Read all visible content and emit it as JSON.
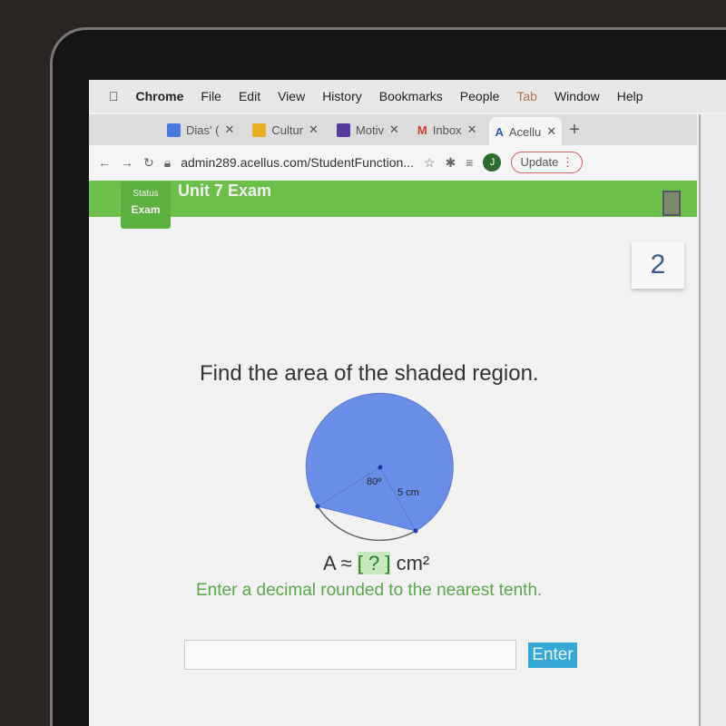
{
  "menubar": {
    "items": [
      "Chrome",
      "File",
      "Edit",
      "View",
      "History",
      "Bookmarks",
      "People",
      "Tab",
      "Window",
      "Help"
    ]
  },
  "tabs": [
    {
      "label": "Dias' (",
      "icon": "google-docs-icon",
      "color": "#4a7ae0"
    },
    {
      "label": "Cultur",
      "icon": "google-slides-icon",
      "color": "#e8b020"
    },
    {
      "label": "Motiv",
      "icon": "google-forms-icon",
      "color": "#5a3aa0"
    },
    {
      "label": "Inbox",
      "icon": "gmail-icon",
      "color": "#d04030"
    },
    {
      "label": "Acellu",
      "icon": "acellus-icon",
      "color": "#2a5ab0",
      "active": true
    }
  ],
  "address": {
    "url": "admin289.acellus.com/StudentFunction...",
    "profile": "J",
    "update": "Update"
  },
  "exam": {
    "status_label": "Status",
    "status_value": "Exam",
    "title": "Unit 7 Exam",
    "question_number": "2"
  },
  "question": {
    "text": "Find the area of the shaded region.",
    "angle": "80º",
    "radius": "5 cm",
    "answer_prefix": "A ≈ ",
    "placeholder": "[ ? ]",
    "answer_unit": " cm²",
    "hint": "Enter a decimal rounded to the nearest tenth."
  },
  "input": {
    "value": "",
    "enter_label": "Enter"
  },
  "colors": {
    "header_green": "#6cc04a",
    "shade": "#6a8ee8",
    "enter": "#35a8d8"
  }
}
